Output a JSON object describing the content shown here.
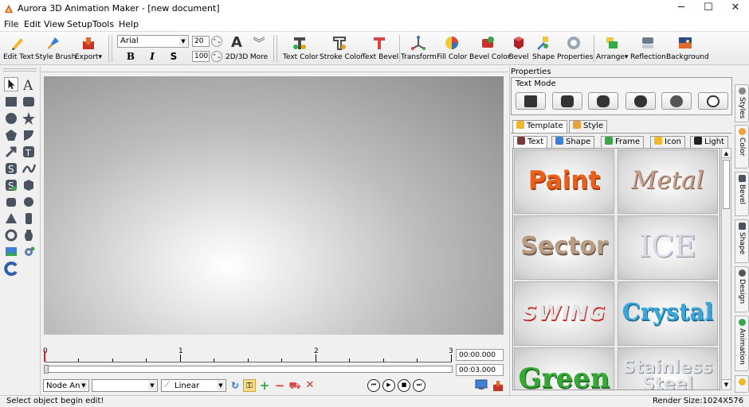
{
  "window": {
    "title": "Aurora 3D Animation Maker - [new document]",
    "minimize": "─",
    "maximize": "☐",
    "close": "✕"
  },
  "menu": [
    "File",
    "Edit",
    "View",
    "Setup",
    "Tools",
    "Help"
  ],
  "toolbar": {
    "edit_text": "Edit Text",
    "style_brush": "Style Brush",
    "export": "Export▾",
    "font": "Arial",
    "font_size": "20",
    "font_scale": "100",
    "bold": "B",
    "italic": "I",
    "strike": "S",
    "toggle_2d3d": "2D/3D",
    "more": "More",
    "text_color": "Text Color",
    "stroke_color": "Stroke Color",
    "text_bevel": "Text Bevel",
    "transform": "Transform",
    "fill_color": "Fill Color",
    "bevel_color": "Bevel Color",
    "bevel": "Bevel",
    "shape": "Shape",
    "properties": "Properties",
    "arrange": "Arrange▾",
    "reflection": "Reflection",
    "background": "Background"
  },
  "timeline": {
    "marks": [
      "0",
      "1",
      "2",
      "3"
    ],
    "current_time": "00:00.000",
    "total_time": "00:03.000",
    "node_ani": "Node Ani",
    "empty_combo": "",
    "interp": "Linear"
  },
  "properties": {
    "title": "Properties",
    "text_mode": "Text Mode",
    "tabs_top": [
      "Template",
      "Style"
    ],
    "tabs_sub": [
      "Text",
      "Shape",
      "Frame",
      "Icon",
      "Light"
    ],
    "templates": [
      {
        "label": "Paint",
        "color": "#e8611c"
      },
      {
        "label": "Metal",
        "color": "#b0846f"
      },
      {
        "label": "Sector",
        "color": "#9b7f66"
      },
      {
        "label": "ICE",
        "color": "#c8cbd6"
      },
      {
        "label": "SWING",
        "color": "#c2302a"
      },
      {
        "label": "Crystal",
        "color": "#3aa7d8"
      },
      {
        "label": "Green",
        "color": "#35a835"
      },
      {
        "label": "Stainless Steel",
        "color": "#a9aeb3"
      }
    ]
  },
  "side_tabs": [
    "Styles",
    "Color",
    "Bevel",
    "Shape",
    "Design",
    "Animation"
  ],
  "status": {
    "message": "Select object begin edit!",
    "render_size": "Render Size:1024X576"
  }
}
